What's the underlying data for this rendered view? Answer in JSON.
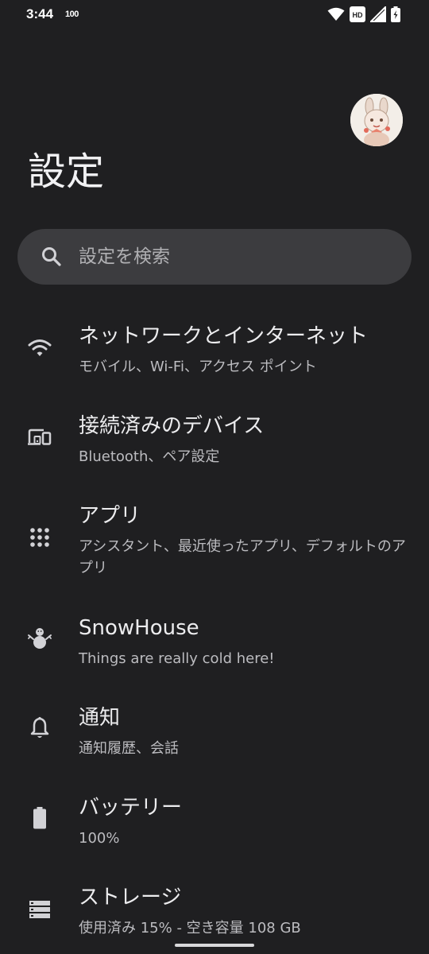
{
  "status_bar": {
    "time": "3:44",
    "extra_indicator": "100",
    "hd_label": "HD",
    "icons": [
      "wifi-icon",
      "hd-voice-icon",
      "cell-signal-icon",
      "battery-charging-icon"
    ]
  },
  "header": {
    "title": "設定",
    "avatar_icon": "profile-avatar"
  },
  "search": {
    "placeholder": "設定を検索",
    "icon": "search-icon"
  },
  "items": [
    {
      "icon": "wifi-icon",
      "title": "ネットワークとインターネット",
      "subtitle": "モバイル、Wi-Fi、アクセス ポイント"
    },
    {
      "icon": "connected-devices-icon",
      "title": "接続済みのデバイス",
      "subtitle": "Bluetooth、ペア設定"
    },
    {
      "icon": "apps-grid-icon",
      "title": "アプリ",
      "subtitle": "アシスタント、最近使ったアプリ、デフォルトのアプリ"
    },
    {
      "icon": "snowman-icon",
      "title": "SnowHouse",
      "subtitle": "Things are really cold here!"
    },
    {
      "icon": "bell-icon",
      "title": "通知",
      "subtitle": "通知履歴、会話"
    },
    {
      "icon": "battery-icon",
      "title": "バッテリー",
      "subtitle": "100%"
    },
    {
      "icon": "storage-icon",
      "title": "ストレージ",
      "subtitle": "使用済み 15% - 空き容量 108 GB"
    }
  ],
  "colors": {
    "background": "#1f1f21",
    "search_bg": "#3c3c3f",
    "icon": "#d2d2d6",
    "title_text": "#ececee",
    "subtitle_text": "#bcbcc0"
  }
}
